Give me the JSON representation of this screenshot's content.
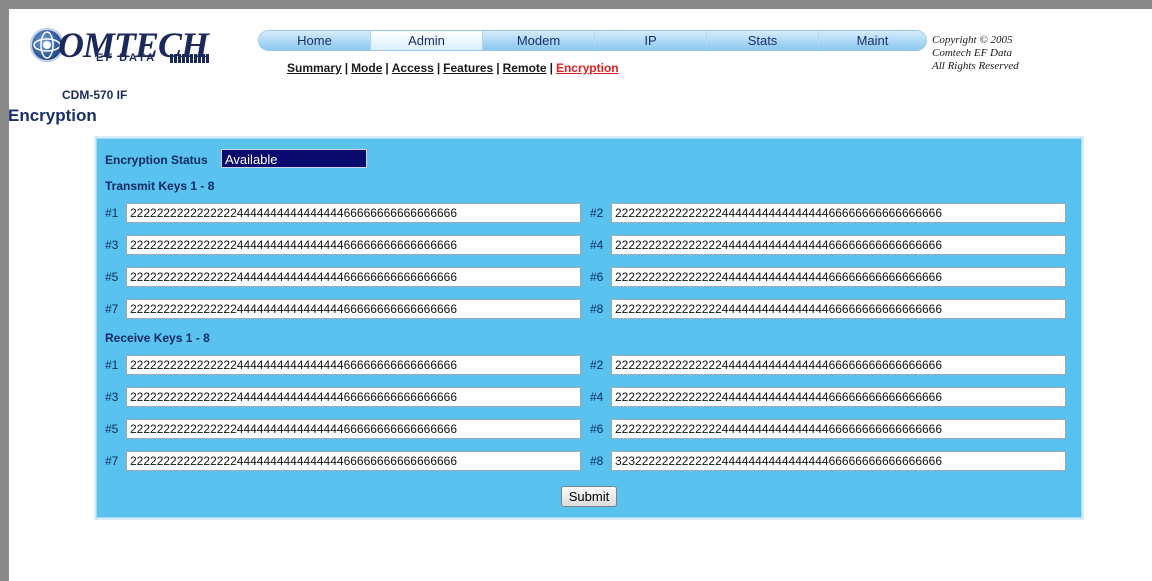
{
  "brand": {
    "logo_text": "OMTECH",
    "logo_sub": "EF DATA",
    "device": "CDM-570 IF"
  },
  "nav": {
    "tabs": [
      "Home",
      "Admin",
      "Modem",
      "IP",
      "Stats",
      "Maint"
    ],
    "active": "Admin"
  },
  "subnav": {
    "items": [
      "Summary",
      "Mode",
      "Access",
      "Features",
      "Remote",
      "Encryption"
    ],
    "current": "Encryption",
    "separator": "|"
  },
  "copyright": {
    "line1": "Copyright © 2005",
    "line2": "Comtech EF Data",
    "line3": "All Rights Reserved"
  },
  "page_title": "Encryption",
  "form": {
    "status_label": "Encryption Status",
    "status_value": "Available",
    "transmit_title": "Transmit Keys 1 - 8",
    "receive_title": "Receive Keys 1 - 8",
    "transmit_keys": [
      {
        "label": "#1",
        "value": "2222222222222222444444444444444466666666666666666"
      },
      {
        "label": "#2",
        "value": "2222222222222222444444444444444466666666666666666"
      },
      {
        "label": "#3",
        "value": "2222222222222222444444444444444466666666666666666"
      },
      {
        "label": "#4",
        "value": "2222222222222222444444444444444466666666666666666"
      },
      {
        "label": "#5",
        "value": "2222222222222222444444444444444466666666666666666"
      },
      {
        "label": "#6",
        "value": "2222222222222222444444444444444466666666666666666"
      },
      {
        "label": "#7",
        "value": "2222222222222222444444444444444466666666666666666"
      },
      {
        "label": "#8",
        "value": "2222222222222222444444444444444466666666666666666"
      }
    ],
    "receive_keys": [
      {
        "label": "#1",
        "value": "2222222222222222444444444444444466666666666666666"
      },
      {
        "label": "#2",
        "value": "2222222222222222444444444444444466666666666666666"
      },
      {
        "label": "#3",
        "value": "2222222222222222444444444444444466666666666666666"
      },
      {
        "label": "#4",
        "value": "2222222222222222444444444444444466666666666666666"
      },
      {
        "label": "#5",
        "value": "2222222222222222444444444444444466666666666666666"
      },
      {
        "label": "#6",
        "value": "2222222222222222444444444444444466666666666666666"
      },
      {
        "label": "#7",
        "value": "2222222222222222444444444444444466666666666666666"
      },
      {
        "label": "#8",
        "value": "3232222222222222444444444444444466666666666666666"
      }
    ],
    "submit_label": "Submit"
  }
}
